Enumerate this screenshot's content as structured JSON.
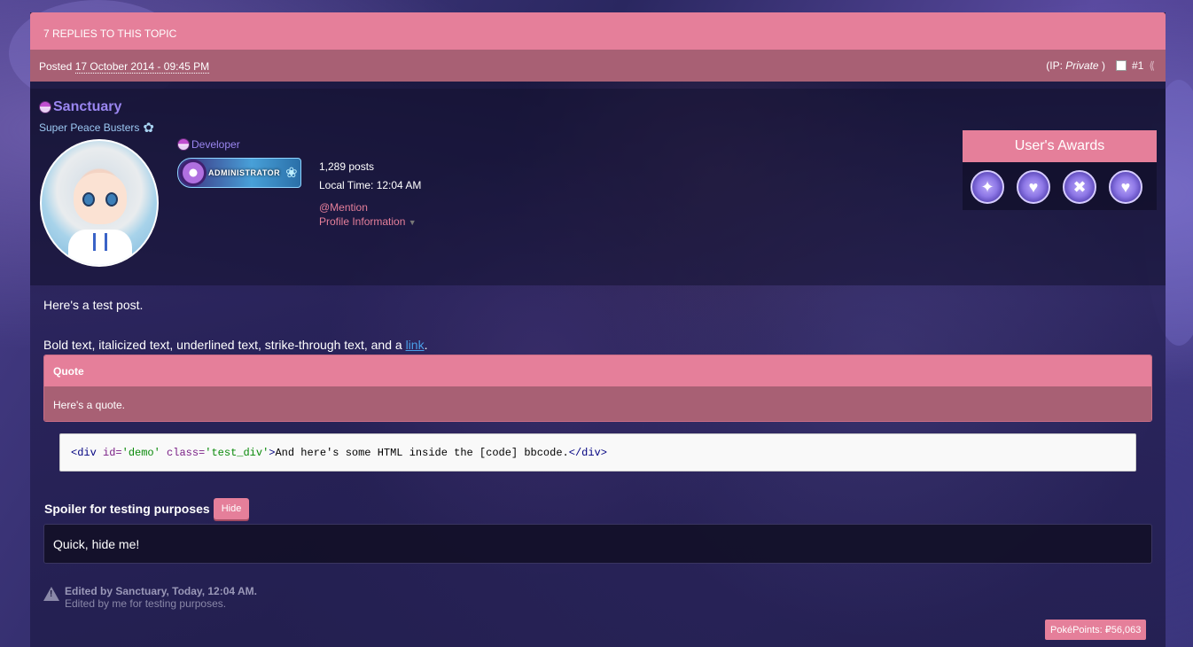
{
  "topic": {
    "replies_label": "7 REPLIES TO THIS TOPIC"
  },
  "post_header": {
    "posted_prefix": "Posted",
    "date": "17 October 2014 - 09:45 PM",
    "ip_prefix": "(IP:",
    "ip_value": "Private",
    "ip_suffix": ")",
    "post_number": "#1"
  },
  "author": {
    "username": "Sanctuary",
    "group_title": "Super Peace Busters",
    "role": "Developer",
    "badge_text": "ADMINISTRATOR",
    "posts": "1,289 posts",
    "local_time": "Local Time: 12:04 AM",
    "mention_link": "@Mention",
    "profile_info_link": "Profile Information"
  },
  "awards": {
    "title": "User's Awards",
    "medals": [
      "medal-1",
      "medal-2",
      "medal-3",
      "medal-4"
    ]
  },
  "post": {
    "line1": "Here's a test post.",
    "line2_text": "Bold text, italicized text, underlined text, strike-through text, and a",
    "line2_link": "link",
    "line2_end": ".",
    "quote_header": "Quote",
    "quote_body": "Here's a quote.",
    "code_open_tag": "<div",
    "code_id_attr": " id=",
    "code_id_val": "'demo'",
    "code_class_attr": " class=",
    "code_class_val": "'test_div'",
    "code_gt": ">",
    "code_text": "And here's some HTML inside the [code] bbcode.",
    "code_close_tag": "</div>",
    "spoiler_title": "Spoiler for testing purposes",
    "spoiler_button": "Hide",
    "spoiler_body": "Quick, hide me!"
  },
  "edit_note": {
    "line1": "Edited by Sanctuary, Today, 12:04 AM.",
    "line2": "Edited by me for testing purposes."
  },
  "points": {
    "label": "PokéPoints:",
    "value": "₽56,063"
  },
  "colors": {
    "accent": "#e57f9a",
    "accent_dark": "#a86074",
    "username": "#9a86f0"
  }
}
